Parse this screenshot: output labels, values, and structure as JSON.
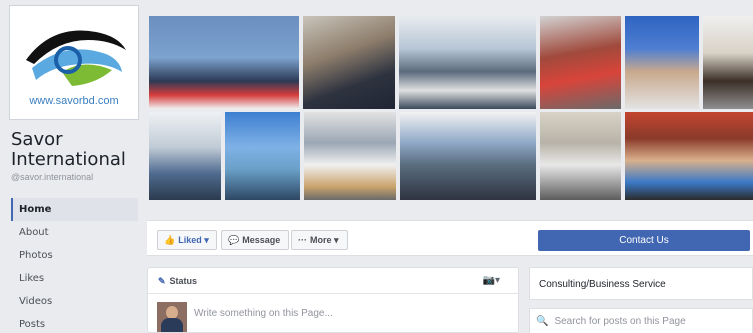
{
  "profile": {
    "url_text": "www.savorbd.com",
    "logo_colors": {
      "blue": "#1a5fa8",
      "green": "#7dbb34",
      "dark": "#111111",
      "light_blue": "#5aa9e0"
    }
  },
  "page": {
    "name": "Savor International",
    "handle": "@savor.international"
  },
  "nav": {
    "items": [
      {
        "label": "Home"
      },
      {
        "label": "About"
      },
      {
        "label": "Photos"
      },
      {
        "label": "Likes"
      },
      {
        "label": "Videos"
      },
      {
        "label": "Posts"
      }
    ]
  },
  "actions": {
    "liked_label": "Liked ▾",
    "message_label": "Message",
    "more_label": "More ▾",
    "contact_label": "Contact Us"
  },
  "composer": {
    "header_label": "Status",
    "placeholder": "Write something on this Page..."
  },
  "sidebar_right": {
    "category": "Consulting/Business Service",
    "search_placeholder": "Search for posts on this Page"
  },
  "icons": {
    "thumb": "thumbs-up-icon",
    "message": "chat-bubble-icon",
    "more": "ellipsis-icon",
    "pencil": "pencil-icon",
    "camera": "camera-icon",
    "search": "search-icon"
  },
  "colors": {
    "facebook_blue": "#4267b2",
    "page_bg": "#e9ebee"
  }
}
